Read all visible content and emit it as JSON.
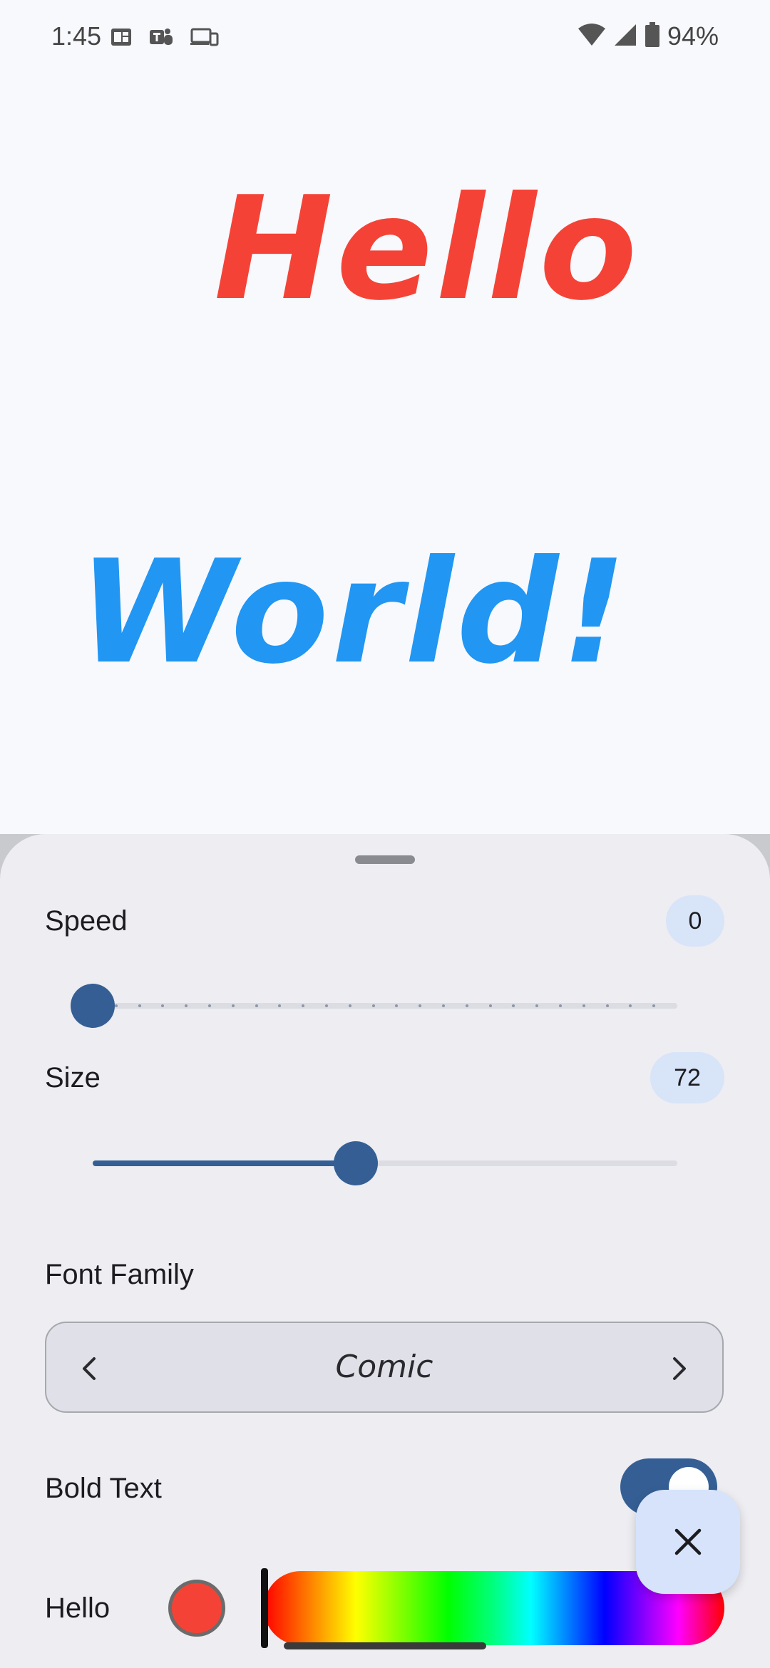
{
  "status_bar": {
    "time": "1:45",
    "battery": "94%",
    "icons": [
      "outlook-icon",
      "teams-icon",
      "devices-icon",
      "wifi-icon",
      "signal-icon",
      "battery-icon"
    ]
  },
  "preview": {
    "word1": "Hello",
    "word1_color": "#f44336",
    "word2": "World!",
    "word2_color": "#2196f3"
  },
  "settings": {
    "speed": {
      "label": "Speed",
      "value": "0",
      "min": 0,
      "max": 25,
      "level": 0
    },
    "size": {
      "label": "Size",
      "value": "72",
      "level": 0.45
    },
    "font_family": {
      "label": "Font Family",
      "value": "Comic"
    },
    "bold": {
      "label": "Bold Text",
      "on": true
    },
    "hello_color": {
      "label": "Hello",
      "color": "#f44336",
      "hue_level": 0
    }
  },
  "colors": {
    "accent": "#355f94",
    "sheet_bg": "#ededf2",
    "chip_bg": "#d8e4f8",
    "fab_bg": "#d6e3fb"
  }
}
